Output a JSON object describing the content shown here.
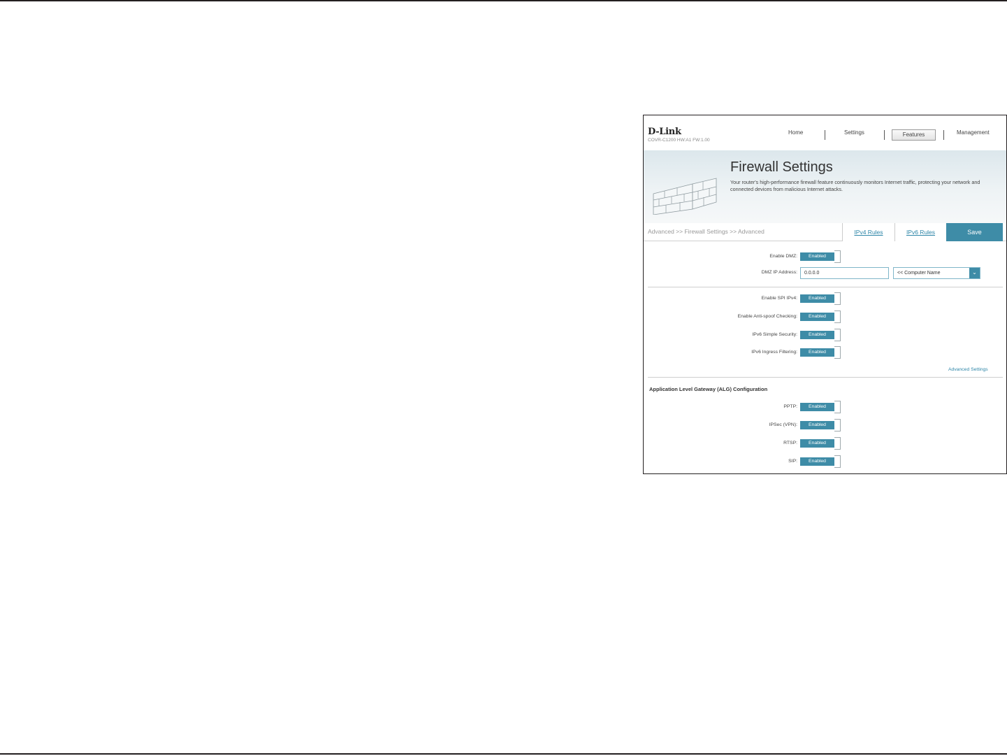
{
  "app": {
    "brand": "D-Link",
    "model": "COVR-C1200 HW:A1 FW:1.00"
  },
  "nav": {
    "items": [
      "Home",
      "Settings",
      "Features",
      "Management"
    ],
    "active": "Features"
  },
  "banner": {
    "title": "Firewall Settings",
    "description": "Your router's high-performance firewall feature continuously monitors Internet traffic, protecting your network and connected devices from malicious Internet attacks."
  },
  "tabs": {
    "breadcrumb": "Advanced >> Firewall Settings >> Advanced",
    "ipv4": "IPv4 Rules",
    "ipv6": "IPv6 Rules",
    "save": "Save"
  },
  "dmz": {
    "enable_label": "Enable DMZ:",
    "enable_value": "Enabled",
    "ip_label": "DMZ IP Address:",
    "ip_value": "0.0.0.0",
    "computer_select": "<< Computer Name"
  },
  "security": {
    "spi_label": "Enable SPI IPv4:",
    "spi_value": "Enabled",
    "antispoof_label": "Enable Anti-spoof Checking:",
    "antispoof_value": "Enabled",
    "ipv6_simple_label": "IPv6 Simple Security:",
    "ipv6_simple_value": "Enabled",
    "ipv6_ingress_label": "IPv6 Ingress Filtering:",
    "ipv6_ingress_value": "Enabled",
    "advanced_link": "Advanced Settings"
  },
  "alg": {
    "title": "Application Level Gateway (ALG) Configuration",
    "pptp_label": "PPTP:",
    "pptp_value": "Enabled",
    "ipsec_label": "IPSec (VPN):",
    "ipsec_value": "Enabled",
    "rtsp_label": "RTSP:",
    "rtsp_value": "Enabled",
    "sip_label": "SIP:",
    "sip_value": "Enabled"
  },
  "colors": {
    "accent": "#3e8ca7",
    "link": "#2e86a8"
  }
}
